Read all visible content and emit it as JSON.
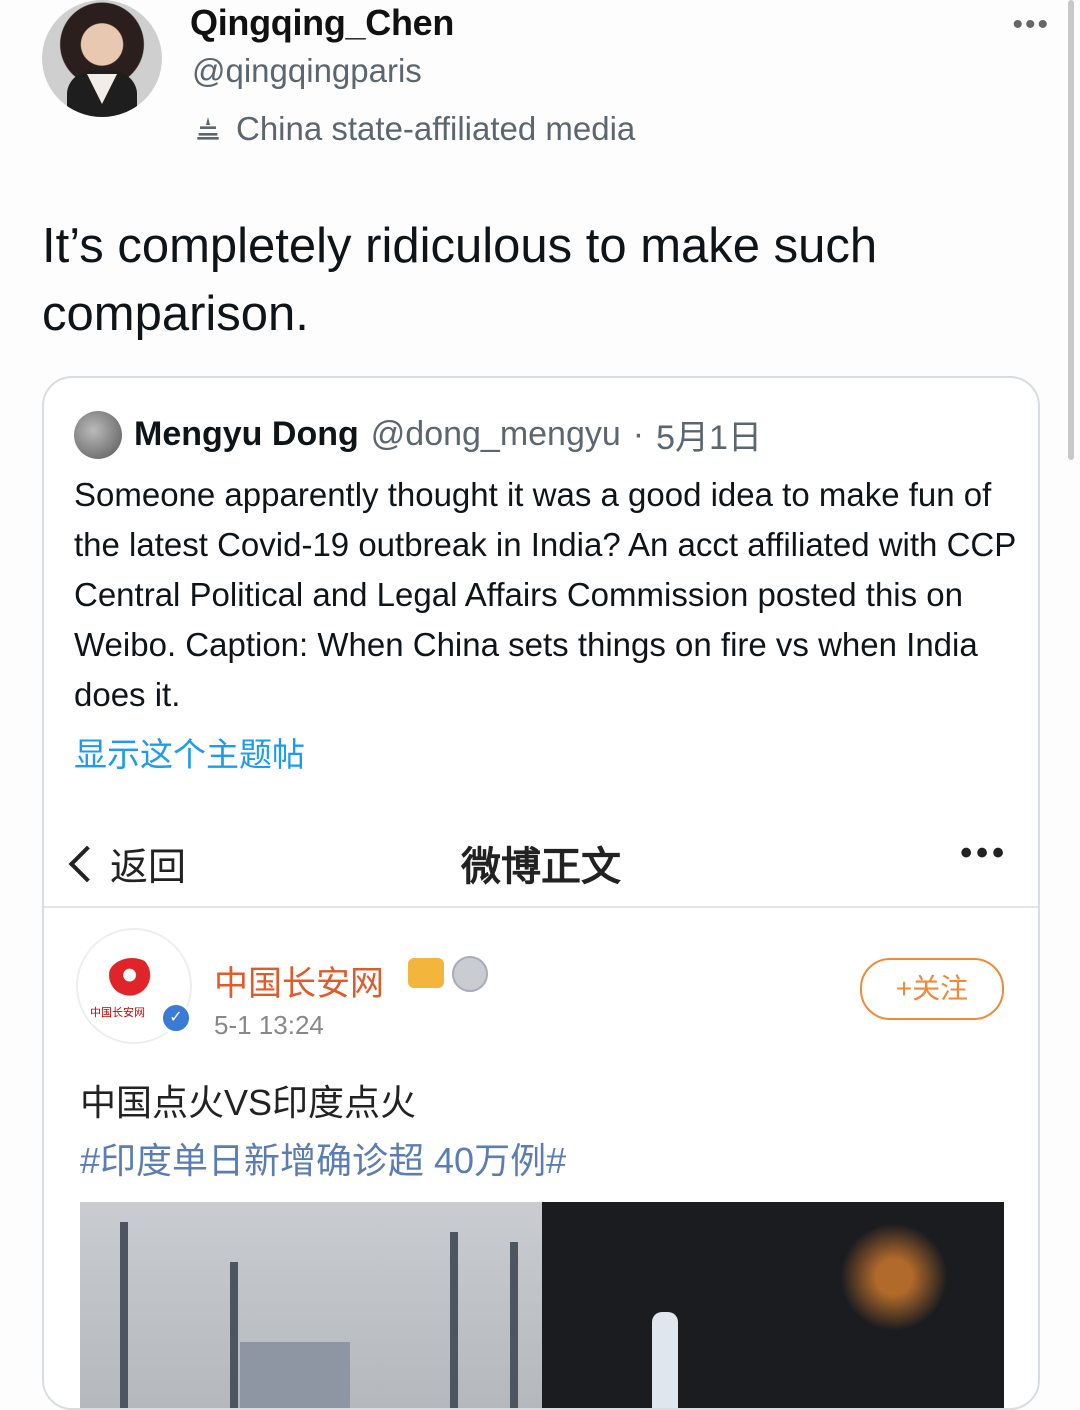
{
  "author": {
    "display_name": "Qingqing_Chen",
    "handle": "@qingqingparis",
    "affiliation": "China state-affiliated media"
  },
  "more_menu": "•••",
  "tweet": {
    "text": "It’s completely ridiculous to make such comparison."
  },
  "quoted": {
    "name": "Mengyu Dong",
    "handle": "@dong_mengyu",
    "separator": "·",
    "date": "5月1日",
    "text": "Someone apparently thought it was a good idea to make fun of the latest Covid-19 outbreak in India? An acct affiliated with CCP Central Political and Legal Affairs Commission posted this on Weibo. Caption: When China sets things on fire vs when India does it.",
    "show_thread": "显示这个主题帖"
  },
  "weibo": {
    "back_label": "返回",
    "title": "微博正文",
    "more": "•••",
    "account_name": "中国长安网",
    "logo_text": "中国长安网",
    "timestamp": "5-1 13:24",
    "follow_label": "+关注",
    "post_text": "中国点火VS印度点火",
    "hashtag": "#印度单日新增确诊超 40万例#"
  },
  "icons": {
    "affiliation": "state-media-icon",
    "verified": "verified-icon"
  },
  "colors": {
    "link": "#1d9bf0",
    "weibo_name": "#e05a2a",
    "follow": "#f08a3a",
    "hashtag": "#5b7db3"
  }
}
